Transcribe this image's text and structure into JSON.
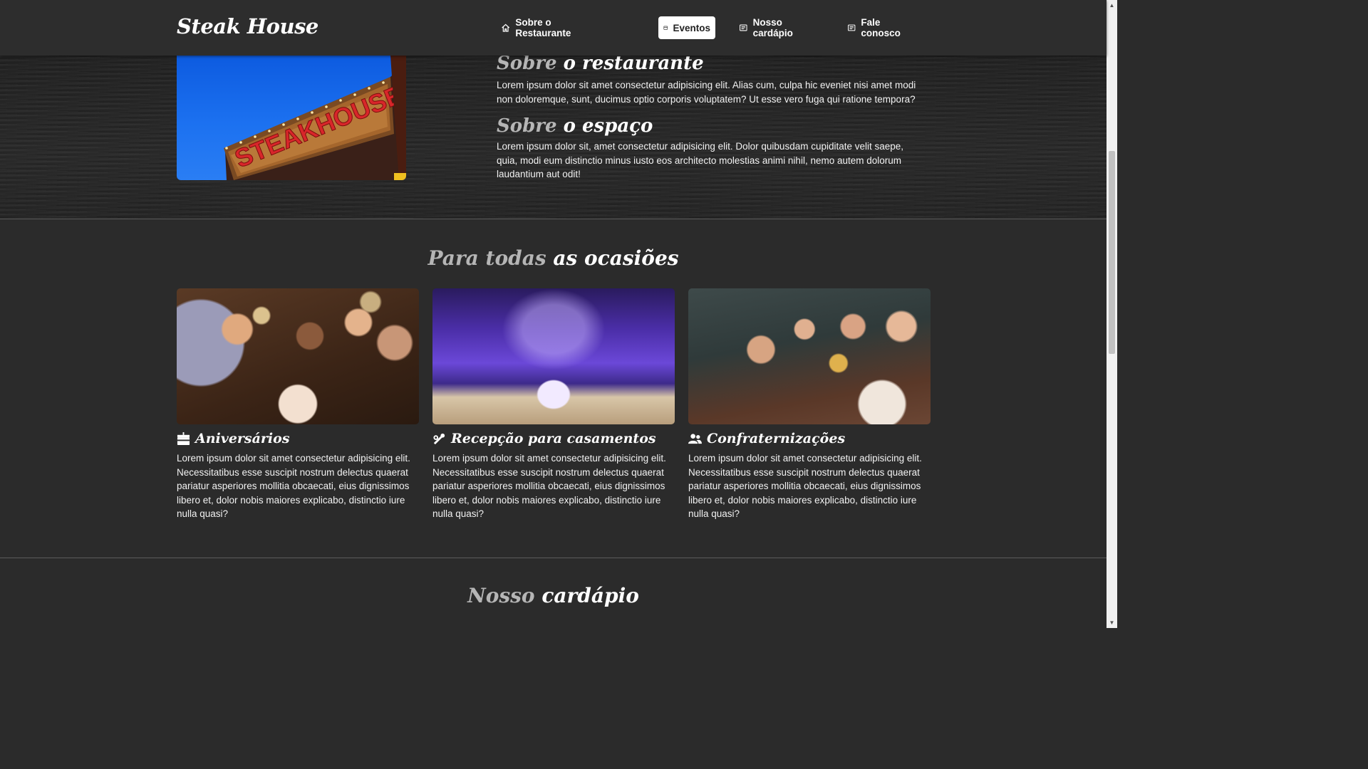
{
  "brand": "Steak House",
  "nav": [
    {
      "label": "Sobre o Restaurante",
      "icon": "home-icon"
    },
    {
      "label": "Eventos",
      "icon": "calendar-icon",
      "active": true
    },
    {
      "label": "Nosso cardápio",
      "icon": "list-icon"
    },
    {
      "label": "Fale conosco",
      "icon": "list-icon"
    }
  ],
  "hero": {
    "image_sign_text": "STEAKHOUSE",
    "about_restaurant": {
      "title_light": "Sobre",
      "title_bold": "o restaurante",
      "text": "Lorem ipsum dolor sit amet consectetur adipisicing elit. Alias cum, culpa hic eveniet nisi amet modi non doloremque, sunt, ducimus optio corporis voluptatem? Ut esse vero fuga qui ratione tempora?"
    },
    "about_space": {
      "title_light": "Sobre",
      "title_bold": "o espaço",
      "text": "Lorem ipsum dolor sit, amet consectetur adipisicing elit. Dolor quibusdam cupiditate velit saepe, quia, modi eum distinctio minus iusto eos architecto molestias animi nihil, nemo autem dolorum laudantium aut odit!"
    }
  },
  "occasions": {
    "title_light": "Para todas",
    "title_bold": "as ocasiões",
    "cards": [
      {
        "title": "Aniversários",
        "icon": "birthday-cake-icon",
        "text": "Lorem ipsum dolor sit amet consectetur adipisicing elit. Necessitatibus esse suscipit nostrum delectus quaerat pariatur asperiores mollitia obcaecati, eius dignissimos libero et, dolor nobis maiores explicabo, distinctio iure nulla quasi?"
      },
      {
        "title": "Recepção para casamentos",
        "icon": "rings-icon",
        "text": "Lorem ipsum dolor sit amet consectetur adipisicing elit. Necessitatibus esse suscipit nostrum delectus quaerat pariatur asperiores mollitia obcaecati, eius dignissimos libero et, dolor nobis maiores explicabo, distinctio iure nulla quasi?"
      },
      {
        "title": "Confraternizações",
        "icon": "users-icon",
        "text": "Lorem ipsum dolor sit amet consectetur adipisicing elit. Necessitatibus esse suscipit nostrum delectus quaerat pariatur asperiores mollitia obcaecati, eius dignissimos libero et, dolor nobis maiores explicabo, distinctio iure nulla quasi?"
      }
    ]
  },
  "menu_section": {
    "title_light": "Nosso",
    "title_bold": "cardápio"
  },
  "colors": {
    "background": "#2b2b2b",
    "navbar": "#2d2d2d",
    "muted_title": "#b5b5b5",
    "text": "#ffffff"
  }
}
